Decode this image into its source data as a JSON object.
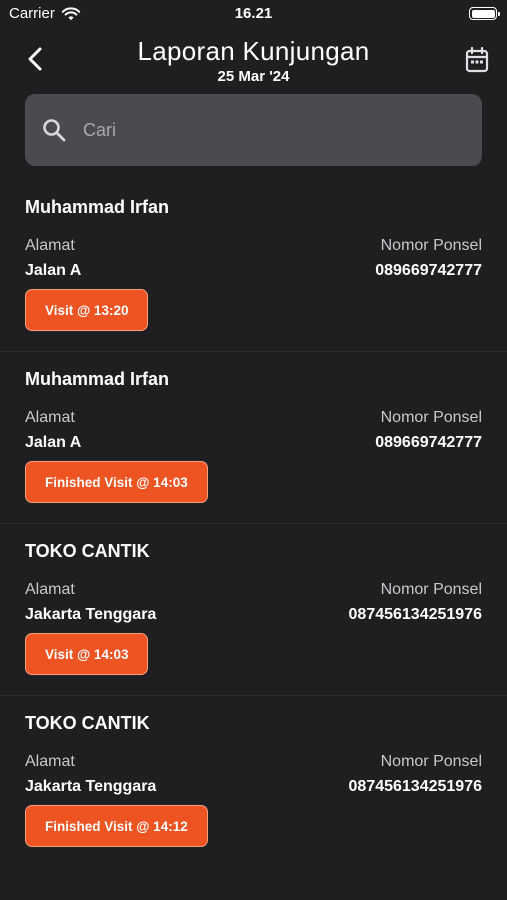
{
  "status_bar": {
    "carrier": "Carrier",
    "time": "16.21"
  },
  "header": {
    "title": "Laporan Kunjungan",
    "date": "25 Mar '24"
  },
  "search": {
    "placeholder": "Cari"
  },
  "visits": [
    {
      "name": "Muhammad Irfan",
      "address_label": "Alamat",
      "address": "Jalan A",
      "phone_label": "Nomor Ponsel",
      "phone": "089669742777",
      "status_button": "Visit @ 13:20"
    },
    {
      "name": "Muhammad Irfan",
      "address_label": "Alamat",
      "address": "Jalan A",
      "phone_label": "Nomor Ponsel",
      "phone": "089669742777",
      "status_button": "Finished Visit @ 14:03"
    },
    {
      "name": "TOKO CANTIK",
      "address_label": "Alamat",
      "address": "Jakarta Tenggara",
      "phone_label": "Nomor Ponsel",
      "phone": "087456134251976",
      "status_button": "Visit @ 14:03"
    },
    {
      "name": "TOKO CANTIK",
      "address_label": "Alamat",
      "address": "Jakarta Tenggara",
      "phone_label": "Nomor Ponsel",
      "phone": "087456134251976",
      "status_button": "Finished Visit @ 14:12"
    }
  ],
  "colors": {
    "background": "#1f1f21",
    "accent": "#ee5322",
    "search_bg": "#4b4a50"
  }
}
